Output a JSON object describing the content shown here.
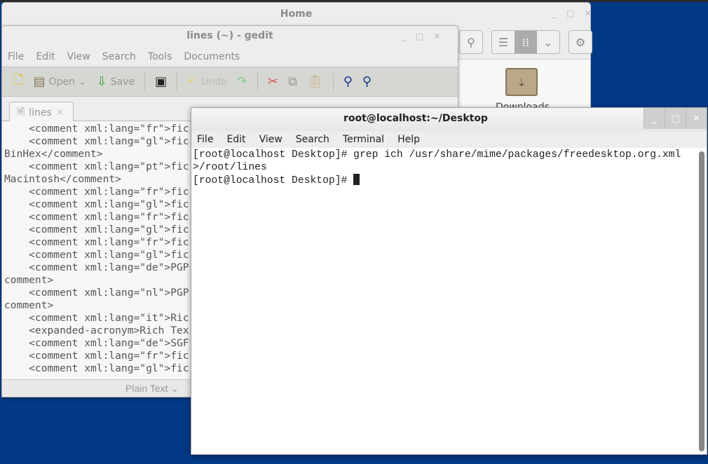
{
  "nautilus": {
    "title": "Home",
    "folder_label": "Downloads"
  },
  "gedit": {
    "title": "lines (~) - gedit",
    "menu": [
      "File",
      "Edit",
      "View",
      "Search",
      "Tools",
      "Documents"
    ],
    "toolbar": {
      "open": "Open",
      "save": "Save",
      "undo": "Undo"
    },
    "tab": "lines",
    "lines": [
      "    <comment xml:lang=\"fr\">fic",
      "    <comment xml:lang=\"gl\">fic",
      "BinHex</comment>",
      "    <comment xml:lang=\"pt\">fic",
      "Macintosh</comment>",
      "    <comment xml:lang=\"fr\">fic",
      "    <comment xml:lang=\"gl\">fic",
      "    <comment xml:lang=\"fr\">fic",
      "    <comment xml:lang=\"gl\">fic",
      "    <comment xml:lang=\"fr\">fic",
      "    <comment xml:lang=\"gl\">fic",
      "    <comment xml:lang=\"de\">PGP",
      "comment>",
      "    <comment xml:lang=\"nl\">PGP",
      "comment>",
      "    <comment xml:lang=\"it\">Ric",
      "    <expanded-acronym>Rich Tex",
      "    <comment xml:lang=\"de\">SGF",
      "    <comment xml:lang=\"fr\">fic",
      "    <comment xml:lang=\"gl\">fic"
    ],
    "language": "Plain Text"
  },
  "terminal": {
    "title": "root@localhost:~/Desktop",
    "menu": [
      "File",
      "Edit",
      "View",
      "Search",
      "Terminal",
      "Help"
    ],
    "lines": [
      "[root@localhost Desktop]# grep ich /usr/share/mime/packages/freedesktop.org.xml",
      ">/root/lines",
      "[root@localhost Desktop]# "
    ]
  }
}
